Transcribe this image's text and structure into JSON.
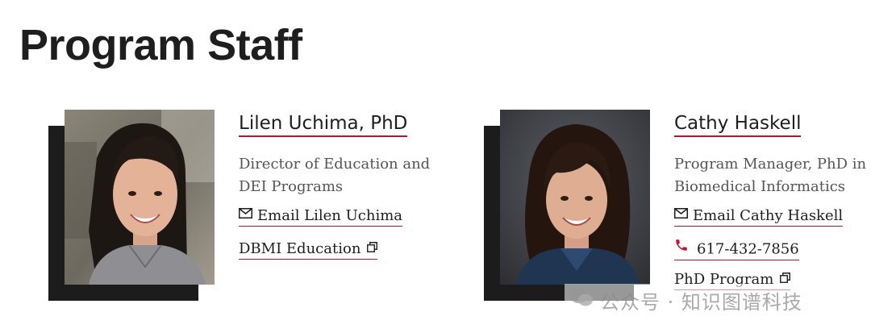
{
  "page": {
    "title": "Program Staff"
  },
  "staff": [
    {
      "name": "Lilen Uchima, PhD",
      "role_line1": "Director of Education and",
      "role_line2": "DEI Programs",
      "email_label": "Email Lilen Uchima",
      "link_label": "DBMI Education",
      "email_icon": "envelope-icon",
      "link_icon": "external-link-icon"
    },
    {
      "name": "Cathy Haskell",
      "role_line1": "Program Manager, PhD in",
      "role_line2": "Biomedical Informatics",
      "email_label": "Email Cathy Haskell",
      "phone": "617-432-7856",
      "link_label": "PhD Program",
      "email_icon": "envelope-icon",
      "phone_icon": "phone-icon",
      "link_icon": "external-link-icon"
    }
  ],
  "watermark": {
    "text": "公众号 · 知识图谱科技"
  },
  "colors": {
    "accent": "#a51c30",
    "text": "#1e1e1e",
    "muted": "#555555",
    "photo_shadow": "#1c1c1c",
    "phone_icon": "#c8102e"
  }
}
